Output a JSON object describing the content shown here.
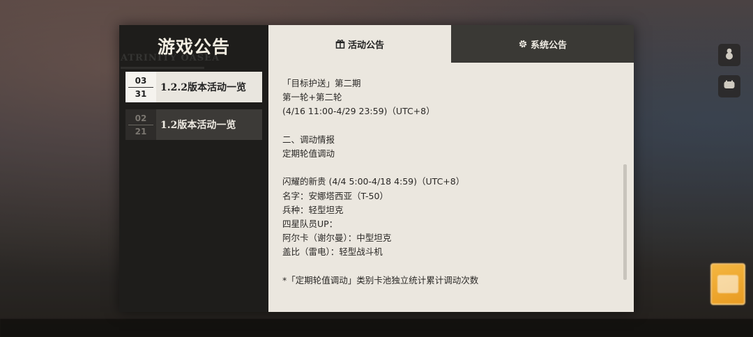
{
  "sidebar": {
    "title": "游戏公告",
    "deco_text": "ATRINITY OASEA",
    "items": [
      {
        "month": "03",
        "day": "31",
        "label": "1.2.2版本活动一览",
        "active": true
      },
      {
        "month": "02",
        "day": "21",
        "label": "1.2版本活动一览",
        "active": false
      }
    ]
  },
  "tabs": [
    {
      "label": "活动公告",
      "icon": "gift-icon",
      "active": true
    },
    {
      "label": "系统公告",
      "icon": "gear-icon",
      "active": false
    }
  ],
  "content": {
    "lines": [
      "「目标护送」第二期",
      "第一轮+第二轮",
      "(4/16 11:00-4/29 23:59)（UTC+8）",
      "",
      "二、调动情报",
      "定期轮值调动",
      "",
      "闪耀的新贵 (4/4 5:00-4/18 4:59)（UTC+8）",
      "名字：安娜塔西亚（T-50）",
      "兵种：轻型坦克",
      "四星队员UP：",
      "阿尔卡（谢尔曼）：中型坦克",
      "盖比（雷电）：轻型战斗机",
      "",
      "*「定期轮值调动」类别卡池独立统计累计调动次数"
    ]
  },
  "side_buttons": [
    {
      "icon": "snowman-icon"
    },
    {
      "icon": "chat-icon"
    }
  ],
  "colors": {
    "panel_left": "#1e1d1b",
    "panel_right": "#ebe7df",
    "tab_inactive": "#3a3935",
    "accent_badge": "#f4b640"
  }
}
